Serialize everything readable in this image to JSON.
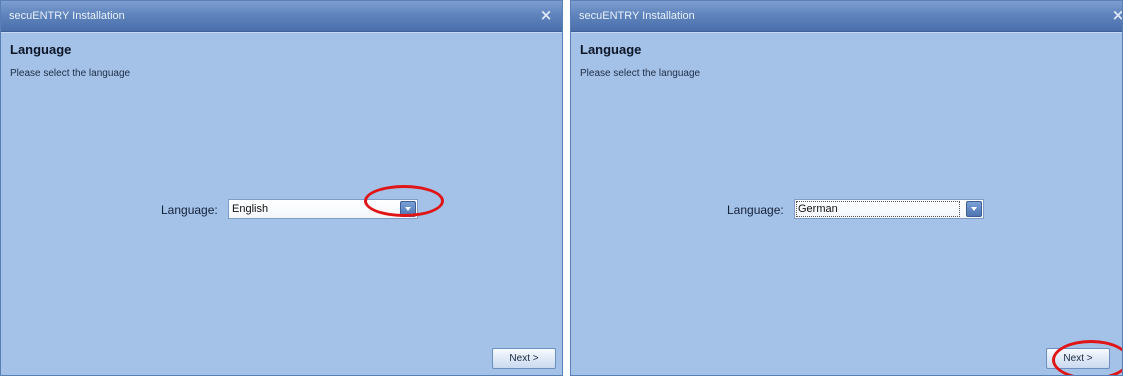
{
  "window_title": "secuENTRY Installation",
  "heading": "Language",
  "subtext": "Please select the language",
  "language_label": "Language:",
  "next_label": "Next >",
  "close_glyph": "×",
  "icons": {
    "close": "close-icon",
    "dropdown": "chevron-down-icon"
  },
  "panels": [
    {
      "selected_language": "English"
    },
    {
      "selected_language": "German"
    }
  ],
  "colors": {
    "window_background": "#a4c1e8",
    "titlebar": "#5f84bd",
    "highlight": "#e01515"
  }
}
